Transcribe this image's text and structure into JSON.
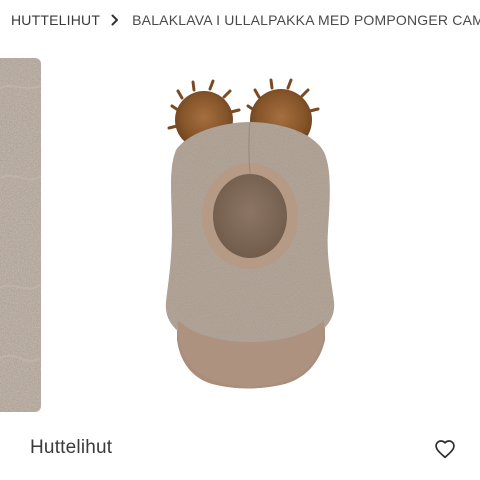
{
  "breadcrumb": {
    "items": [
      {
        "label": "HUTTELIHUT"
      },
      {
        "label": "BALAKLAVA I ULLALPAKKA MED POMPONGER CAMEL"
      }
    ],
    "separator_icon": "chevron-right-icon"
  },
  "gallery": {
    "previous_thumb_icon": "wool-texture-image",
    "main_image_icon": "balaclava-product-image"
  },
  "product": {
    "brand": "Huttelihut",
    "favorite_icon": "heart-outline-icon"
  },
  "colors": {
    "text": "#3a3a3a",
    "wool": "#a8998c",
    "pompom": "#8a5a32",
    "trim": "#b39a88"
  }
}
